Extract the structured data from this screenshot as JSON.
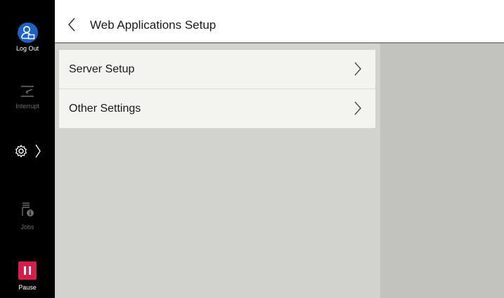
{
  "sidebar": {
    "logout_label": "Log Out",
    "interrupt_label": "Interrupt",
    "jobs_label": "Jobs",
    "pause_label": "Pause"
  },
  "header": {
    "title": "Web Applications Setup"
  },
  "menu": {
    "items": [
      {
        "label": "Server Setup"
      },
      {
        "label": "Other Settings"
      }
    ]
  },
  "colors": {
    "logout_accent": "#1e63c4",
    "pause_accent": "#d2204a",
    "sidebar_bg": "#000000"
  }
}
